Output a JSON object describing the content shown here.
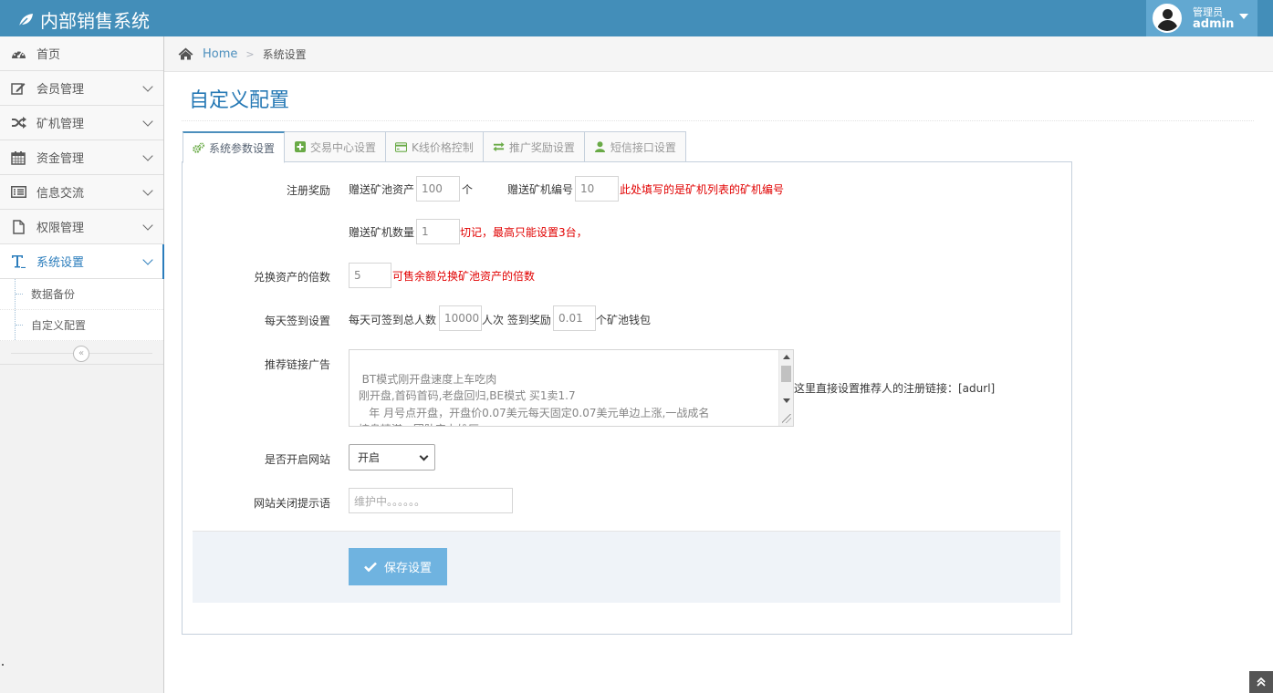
{
  "app": {
    "title": "内部销售系统"
  },
  "user": {
    "role": "管理员",
    "name": "admin"
  },
  "sidebar": {
    "items": [
      {
        "label": "首页",
        "icon": "dashboard-icon"
      },
      {
        "label": "会员管理",
        "icon": "edit-icon"
      },
      {
        "label": "矿机管理",
        "icon": "shuffle-icon"
      },
      {
        "label": "资金管理",
        "icon": "calendar-icon"
      },
      {
        "label": "信息交流",
        "icon": "list-icon"
      },
      {
        "label": "权限管理",
        "icon": "file-icon"
      },
      {
        "label": "系统设置",
        "icon": "text-icon"
      }
    ],
    "subitems": [
      {
        "label": "数据备份"
      },
      {
        "label": "自定义配置"
      }
    ]
  },
  "breadcrumb": {
    "home": "Home",
    "current": "系统设置"
  },
  "page": {
    "title": "自定义配置"
  },
  "tabs": [
    {
      "label": "系统参数设置",
      "icon": "cogs-icon"
    },
    {
      "label": "交易中心设置",
      "icon": "plus-square-icon"
    },
    {
      "label": "K线价格控制",
      "icon": "credit-card-icon"
    },
    {
      "label": "推广奖励设置",
      "icon": "exchange-icon"
    },
    {
      "label": "短信接口设置",
      "icon": "user-icon"
    }
  ],
  "form": {
    "register": {
      "label": "注册奖励",
      "gift_asset_label": "赠送矿池资产",
      "gift_asset_value": "100",
      "gift_asset_unit": "个",
      "gift_machine_label": "赠送矿机编号",
      "gift_machine_value": "10",
      "gift_machine_hint": "此处填写的是矿机列表的矿机编号",
      "gift_count_label": "赠送矿机数量",
      "gift_count_value": "1",
      "gift_count_hint": "切记，最高只能设置3台，"
    },
    "exchange": {
      "label": "兑换资产的倍数",
      "value": "5",
      "hint": "可售余额兑换矿池资产的倍数"
    },
    "signin": {
      "label": "每天签到设置",
      "total_label": "每天可签到总人数",
      "total_value": "10000",
      "total_unit": "人次 签到奖励",
      "reward_value": "0.01",
      "reward_unit": "个矿池钱包"
    },
    "ad": {
      "label": "推荐链接广告",
      "value": "BT模式刚开盘速度上车吃肉\n 刚开盘,首码首码,老盘回归,BE模式 买1卖1.7\n    年 月号点开盘，开盘价0.07美元每天固定0.07美元单边上涨,一战成名\n 控盘精湛，团队实力雄厚",
      "hint": "这里直接设置推荐人的注册链接：[adurl]"
    },
    "site_open": {
      "label": "是否开启网站",
      "value": "开启"
    },
    "close_msg": {
      "label": "网站关闭提示语",
      "placeholder": "维护中。。。。。。"
    },
    "save_label": "保存设置"
  },
  "colors": {
    "navbar": "#438eb9",
    "accent": "#2679b5",
    "hint": "#e10000",
    "save": "#6fb3e0"
  }
}
